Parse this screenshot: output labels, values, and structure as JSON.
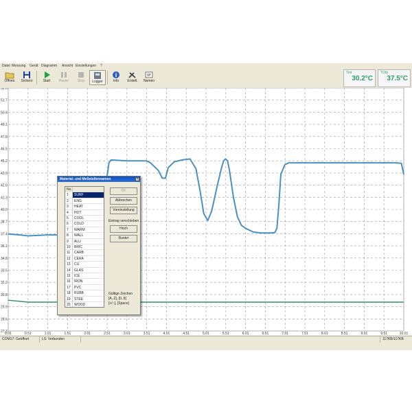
{
  "menu": [
    "Datei",
    "Messung",
    "Gerät",
    "Diagramm",
    "Ansicht",
    "Einstellungen",
    "?"
  ],
  "toolbar": {
    "buttons": [
      {
        "id": "open",
        "label": "Öffnen",
        "icon": "folder-icon",
        "enabled": true
      },
      {
        "id": "save",
        "label": "Sichern",
        "icon": "disk-icon",
        "enabled": true
      },
      {
        "id": "start",
        "label": "Start",
        "icon": "play-icon",
        "enabled": true
      },
      {
        "id": "pause",
        "label": "Pause",
        "icon": "pause-icon",
        "enabled": false
      },
      {
        "id": "stop",
        "label": "Stop",
        "icon": "stop-icon",
        "enabled": false
      },
      {
        "id": "logger",
        "label": "Logger",
        "icon": "logger-icon",
        "enabled": true
      },
      {
        "id": "info",
        "label": "Info",
        "icon": "info-icon",
        "enabled": true
      },
      {
        "id": "create",
        "label": "Erstell.",
        "icon": "tools-icon",
        "enabled": true
      },
      {
        "id": "names",
        "label": "Namen",
        "icon": "names-icon",
        "enabled": true
      }
    ]
  },
  "readouts": [
    {
      "label": "Tint",
      "value": "30.2°C"
    },
    {
      "label": "TObj",
      "value": "37.5°C"
    }
  ],
  "chart_data": {
    "type": "line",
    "xlabel": "",
    "ylabel": "",
    "xlim": [
      0.0,
      10.01
    ],
    "ylim": [
      27.3,
      52.6
    ],
    "x_ticks": [
      "0.01",
      "0.51",
      "1.01",
      "1.51",
      "2.01",
      "2.51",
      "3.01",
      "3.51",
      "4.01",
      "4.51",
      "5.01",
      "5.51",
      "6.01",
      "6.51",
      "7.01",
      "7.51",
      "8.01",
      "8.51",
      "9.01",
      "9.51",
      "10.01"
    ],
    "y_ticks": [
      "27.3",
      "28.6",
      "29.9",
      "30.8",
      "32.2",
      "33.5",
      "34.8",
      "36.1",
      "37.4",
      "38.7",
      "40.0",
      "41.3",
      "42.6",
      "43.9",
      "45.2",
      "46.5",
      "47.8",
      "49.1",
      "50.4",
      "51.7",
      "52.6"
    ],
    "grid": true,
    "series": [
      {
        "color": "#4a90c0",
        "x": [
          0.0,
          0.3,
          0.5,
          1.0,
          1.5,
          2.0,
          2.25,
          2.4,
          2.45,
          2.55,
          2.6,
          3.0,
          3.5,
          3.6,
          3.8,
          3.9,
          3.98,
          4.05,
          4.2,
          4.4,
          4.6,
          4.75,
          4.85,
          4.95,
          5.05,
          5.15,
          5.3,
          5.4,
          5.45,
          5.5,
          5.55,
          5.6,
          5.7,
          5.8,
          5.9,
          6.0,
          6.2,
          6.4,
          6.5,
          6.65,
          6.75,
          6.8,
          6.85,
          6.9,
          7.0,
          7.1,
          7.5,
          8.0,
          8.5,
          9.0,
          9.5,
          9.8,
          9.95,
          10.01
        ],
        "y": [
          37.4,
          37.3,
          37.2,
          37.3,
          37.3,
          37.3,
          37.35,
          37.6,
          42.0,
          44.8,
          45.1,
          45.0,
          45.0,
          44.8,
          44.0,
          43.2,
          43.2,
          44.3,
          44.9,
          45.1,
          45.2,
          44.2,
          42.0,
          39.5,
          38.8,
          39.8,
          42.6,
          44.3,
          45.0,
          45.2,
          45.0,
          44.0,
          41.2,
          39.2,
          38.3,
          38.0,
          37.6,
          37.5,
          37.5,
          37.5,
          37.55,
          38.0,
          40.5,
          43.6,
          44.6,
          44.8,
          44.8,
          44.8,
          44.8,
          44.8,
          44.8,
          44.8,
          44.75,
          43.6
        ]
      },
      {
        "color": "#2e8f74",
        "x": [
          0.0,
          0.5,
          1.0,
          2.0,
          3.0,
          4.0,
          5.0,
          6.0,
          7.0,
          8.0,
          9.0,
          10.0
        ],
        "y": [
          30.5,
          30.3,
          30.3,
          30.3,
          30.3,
          30.3,
          30.3,
          30.3,
          30.3,
          30.3,
          30.3,
          30.3
        ]
      }
    ]
  },
  "status": [
    "COM17: Geöffnet",
    "LS: Verbunden",
    "117KB/117KB"
  ],
  "dialog": {
    "title": "Material- und Meßstellennamen",
    "list_header": "No.",
    "materials": [
      "SURF",
      "ENG",
      "HEAT",
      "HOT",
      "COOL",
      "COLD",
      "WARM",
      "WALL",
      "ALU",
      "BRIC",
      "CARB",
      "CERA",
      "CU",
      "GLAS",
      "ICE",
      "IRON",
      "PVC",
      "RUBB",
      "STEE",
      "WOOD"
    ],
    "selected_index": 0,
    "buttons": {
      "ok": "OK",
      "cancel": "Abbrechen",
      "defaults": "Voreinstellung",
      "up": "Hoch",
      "down": "Runter"
    },
    "move_label": "Eintrag verschieben",
    "valid_chars_label": "Gültige Zeichen",
    "valid_chars_line1": "[A..Z], [0..9]",
    "valid_chars_line2": "[+/:-], [Space]"
  }
}
